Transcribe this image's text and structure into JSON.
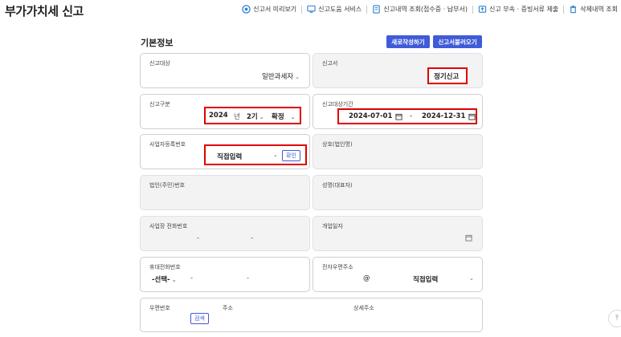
{
  "page": {
    "title": "부가가치세 신고"
  },
  "top_nav": [
    {
      "label": "신고서 미리보기",
      "icon": "preview-icon"
    },
    {
      "label": "신고도움 서비스",
      "icon": "monitor-icon"
    },
    {
      "label": "신고내역 조회(접수증 · 납부서)",
      "icon": "document-icon"
    },
    {
      "label": "신고 부속 · 증빙서류 제출",
      "icon": "upload-icon"
    },
    {
      "label": "삭제내역 조회",
      "icon": "trash-icon"
    }
  ],
  "section": {
    "title": "기본정보",
    "new_button": "새로작성하기",
    "load_button": "신고서불러오기"
  },
  "form": {
    "report_target": {
      "label": "신고대상",
      "value": "일반과세자"
    },
    "report_form": {
      "label": "신고서",
      "value": "정기신고"
    },
    "report_type": {
      "label": "신고구분",
      "year": "2024",
      "year_unit": "년",
      "period": "2기",
      "status": "확정"
    },
    "report_period": {
      "label": "신고대상기간",
      "start": "2024-07-01",
      "separator": "-",
      "end": "2024-12-31"
    },
    "business_no": {
      "label": "사업자등록번호",
      "value": "직접입력",
      "confirm": "확인"
    },
    "company_name": {
      "label": "상호(법인명)"
    },
    "corp_no": {
      "label": "법인(주민)번호"
    },
    "rep_name": {
      "label": "성명(대표자)"
    },
    "biz_phone": {
      "label": "사업장 전화번호",
      "sep1": "-",
      "sep2": "-"
    },
    "open_date": {
      "label": "개업일자"
    },
    "mobile": {
      "label": "휴대전화번호",
      "prefix": "-선택-",
      "sep1": "-",
      "sep2": "-"
    },
    "email": {
      "label": "전자우편주소",
      "at": "@",
      "domain": "직접입력"
    },
    "address": {
      "postal_label": "우편번호",
      "search": "검색",
      "addr_label": "주소",
      "detail_label": "상세주소"
    }
  },
  "colors": {
    "accent": "#3f5bd8",
    "highlight": "#e00000",
    "disabled_bg": "#f3f3f3"
  }
}
